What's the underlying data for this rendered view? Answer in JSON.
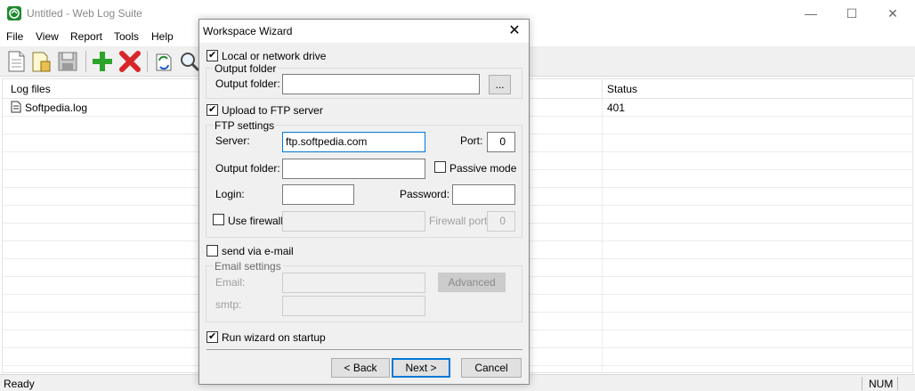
{
  "window": {
    "title": "Untitled - Web Log Suite",
    "minimize": "—",
    "maximize": "☐",
    "close": "✕"
  },
  "menu": [
    "File",
    "View",
    "Report",
    "Tools",
    "Help"
  ],
  "toolbar": {
    "icons": [
      "new-document-icon",
      "open-folder-icon",
      "save-icon",
      "add-icon",
      "delete-icon",
      "update-icon",
      "search-icon"
    ],
    "colors": {
      "add": "#2aa52a",
      "delete": "#d7262b"
    }
  },
  "log_list": {
    "columns": [
      "Log files",
      "Status"
    ],
    "rows": [
      {
        "name": "Softpedia.log",
        "status": "401"
      }
    ]
  },
  "statusbar": {
    "text": "Ready",
    "num": "NUM"
  },
  "dialog": {
    "title": "Workspace Wizard",
    "local_drive": {
      "label": "Local or network drive",
      "checked": true
    },
    "output_folder_group": {
      "title": "Output folder",
      "label": "Output folder:",
      "value": "",
      "browse": "..."
    },
    "ftp": {
      "label": "Upload to FTP server",
      "checked": true
    },
    "ftp_settings": {
      "title": "FTP settings",
      "server_label": "Server:",
      "server_value": "ftp.softpedia.com",
      "port_label": "Port:",
      "port_value": "0",
      "output_folder_label": "Output folder:",
      "output_folder_value": "",
      "passive_label": "Passive mode",
      "passive_checked": false,
      "login_label": "Login:",
      "login_value": "",
      "password_label": "Password:",
      "password_value": "",
      "firewall_label": "Use firewall",
      "firewall_checked": false,
      "firewall_value": "",
      "firewall_port_label": "Firewall port:",
      "firewall_port_value": "0"
    },
    "email": {
      "label": "send via e-mail",
      "checked": false
    },
    "email_settings": {
      "title": "Email settings",
      "email_label": "Email:",
      "email_value": "",
      "advanced": "Advanced",
      "smtp_label": "smtp:",
      "smtp_value": ""
    },
    "run_on_startup": {
      "label": "Run wizard on startup",
      "checked": true
    },
    "buttons": {
      "back": "< Back",
      "next": "Next >",
      "cancel": "Cancel"
    }
  }
}
